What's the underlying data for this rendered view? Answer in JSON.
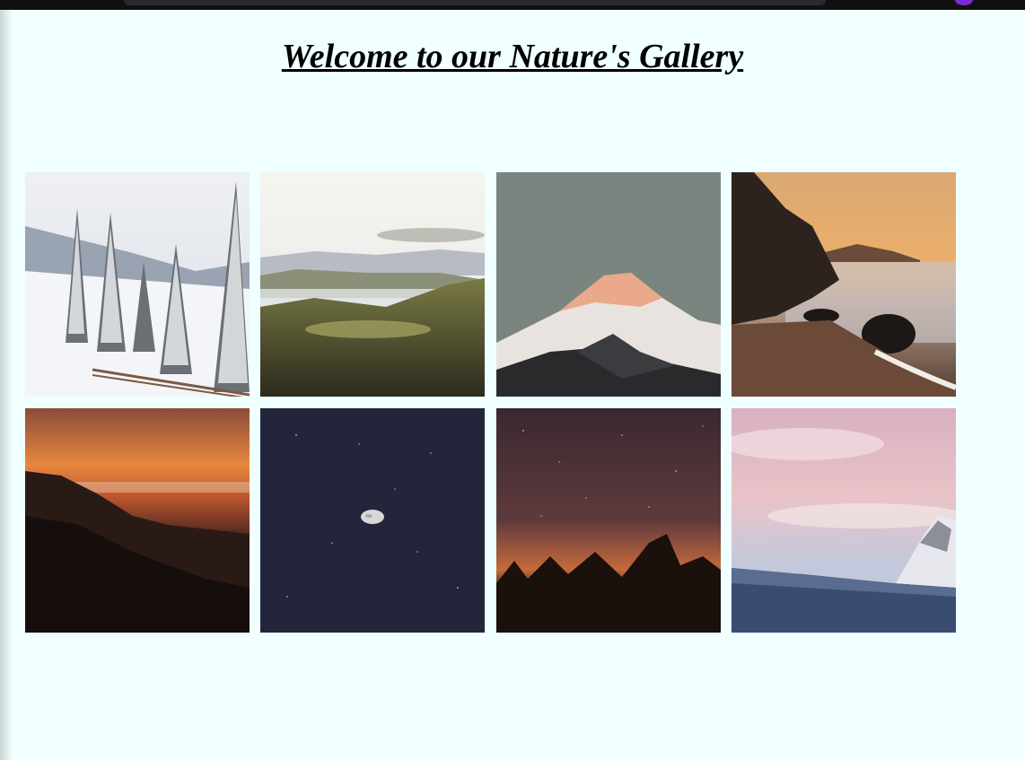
{
  "page": {
    "title": "Welcome to our Nature's Gallery"
  },
  "gallery": {
    "images": [
      {
        "subject": "snowy-forest"
      },
      {
        "subject": "misty-valley"
      },
      {
        "subject": "snow-peak"
      },
      {
        "subject": "sunset-beach"
      },
      {
        "subject": "sunset-hills"
      },
      {
        "subject": "moon-night-sky"
      },
      {
        "subject": "starry-sky"
      },
      {
        "subject": "snowy-mountain-pink-sky"
      }
    ]
  },
  "colors": {
    "background": "#f0ffff",
    "title": "#000000"
  }
}
